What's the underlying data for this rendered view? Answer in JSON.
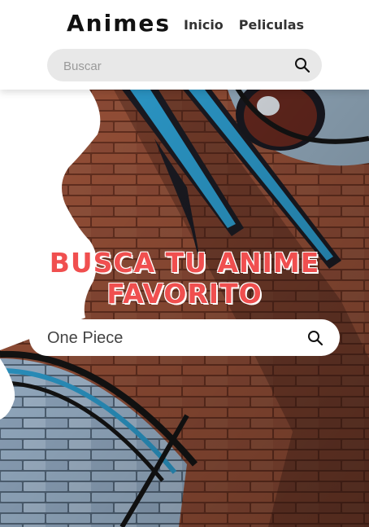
{
  "header": {
    "logo": "Animes",
    "nav": [
      {
        "label": "Inicio"
      },
      {
        "label": "Peliculas"
      }
    ],
    "search": {
      "placeholder": "Buscar",
      "value": "",
      "icon": "search-icon"
    }
  },
  "hero": {
    "title_line1": "BUSCA TU ANIME",
    "title_line2": "FAVORITO",
    "search": {
      "value": "One Piece",
      "icon": "search-icon"
    }
  },
  "colors": {
    "title": "#f04f4f",
    "brick": "#8a4a33",
    "accent_blue": "#2fa4d8"
  }
}
